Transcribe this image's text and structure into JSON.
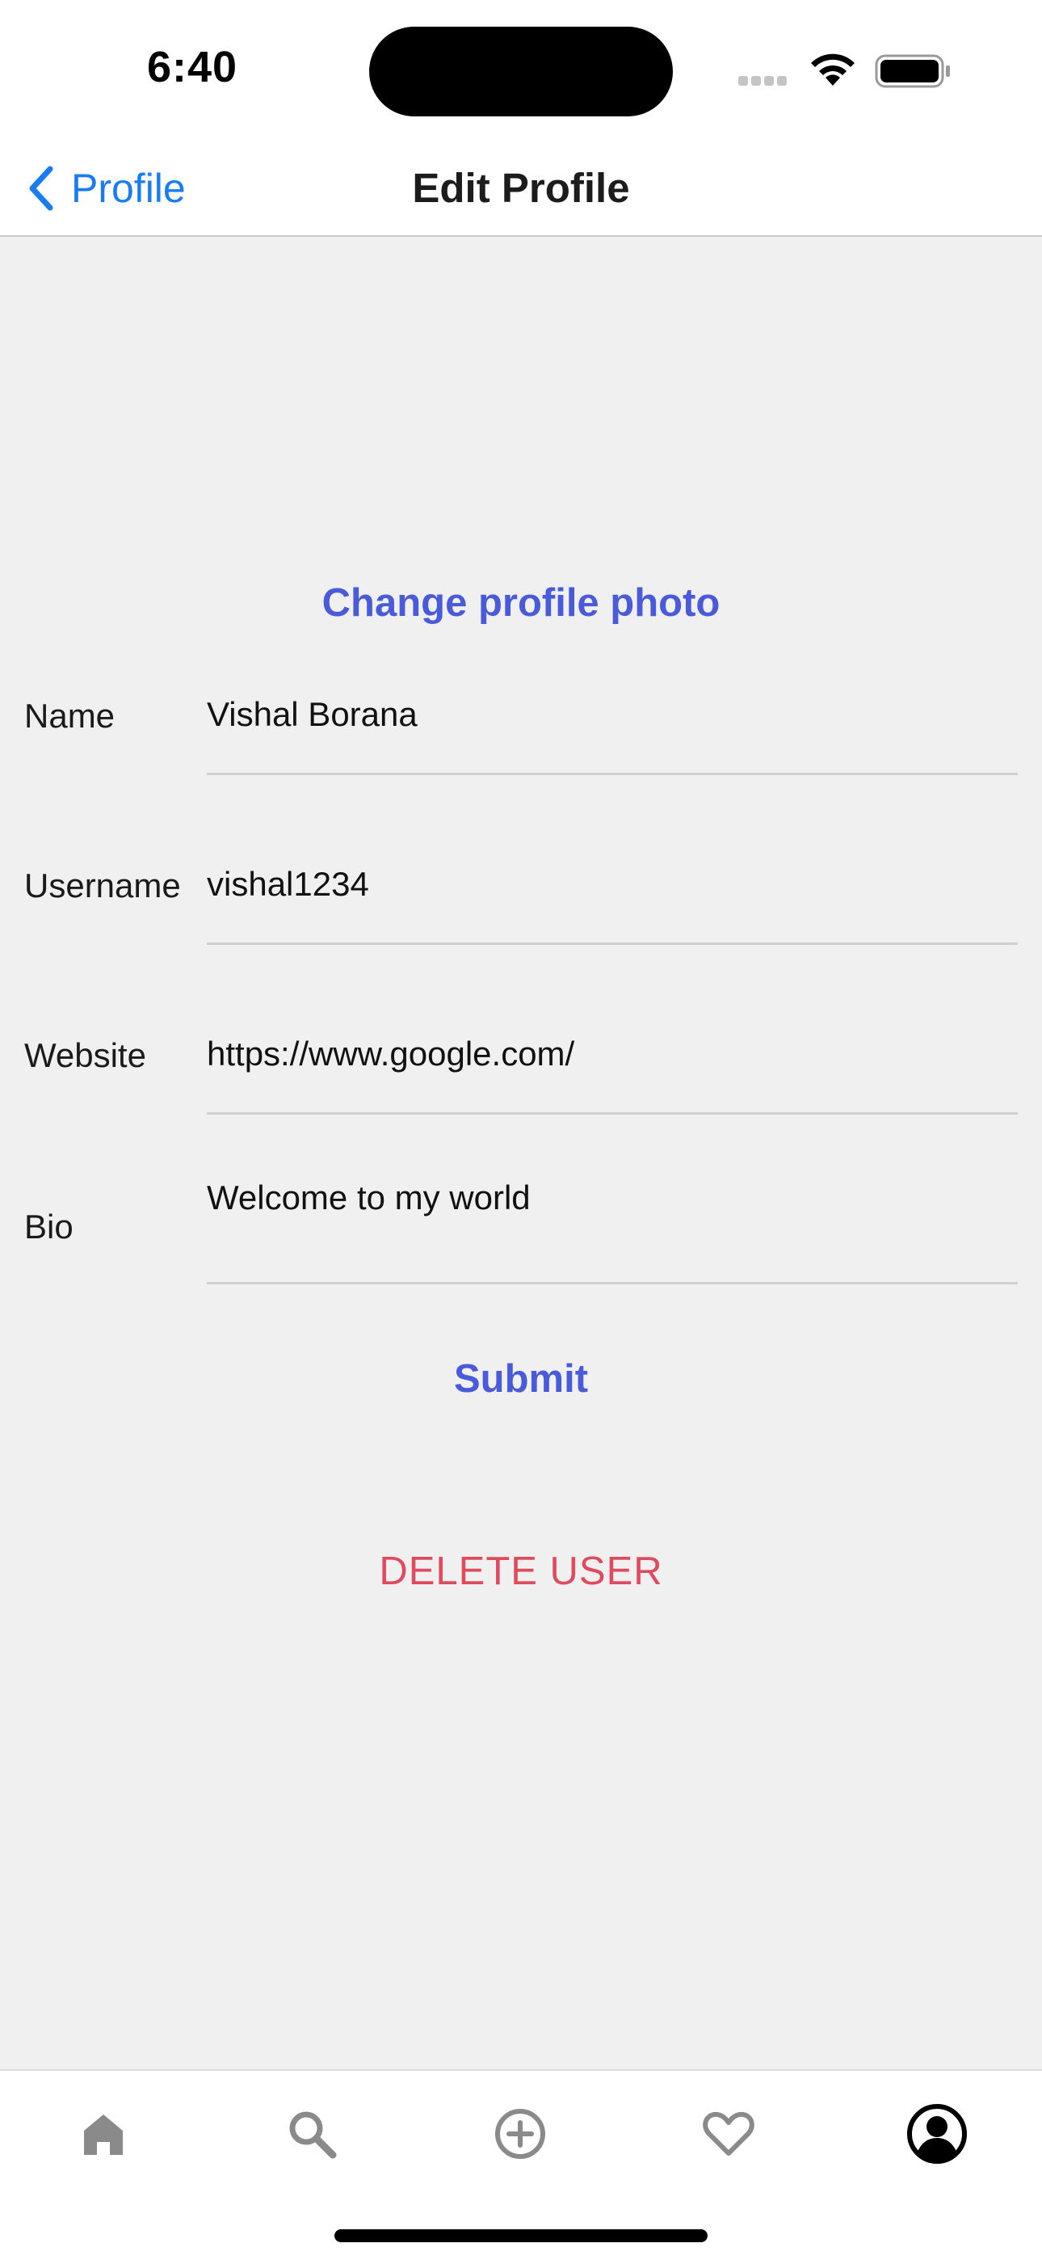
{
  "status_bar": {
    "time": "6:40",
    "icons": [
      "signal-icon",
      "wifi-icon",
      "battery-icon"
    ]
  },
  "nav": {
    "back_label": "Profile",
    "title": "Edit Profile"
  },
  "profile": {
    "change_photo_label": "Change profile photo"
  },
  "form": {
    "fields": [
      {
        "label": "Name",
        "value": "Vishal Borana"
      },
      {
        "label": "Username",
        "value": "vishal1234"
      },
      {
        "label": "Website",
        "value": "https://www.google.com/"
      },
      {
        "label": "Bio",
        "value": "Welcome to my world"
      }
    ],
    "submit_label": "Submit",
    "delete_label": "DELETE USER"
  },
  "tab_bar": {
    "items": [
      {
        "icon": "home-icon",
        "active": false
      },
      {
        "icon": "search-icon",
        "active": false
      },
      {
        "icon": "add-circle-icon",
        "active": false
      },
      {
        "icon": "heart-icon",
        "active": false
      },
      {
        "icon": "profile-icon",
        "active": true
      }
    ]
  },
  "colors": {
    "accent_blue": "#1a7cf2",
    "action_blue": "#4a5bd9",
    "destructive_red": "#e04a5e",
    "background": "#f0f0f0",
    "inactive_icon": "#8a8a8a"
  }
}
